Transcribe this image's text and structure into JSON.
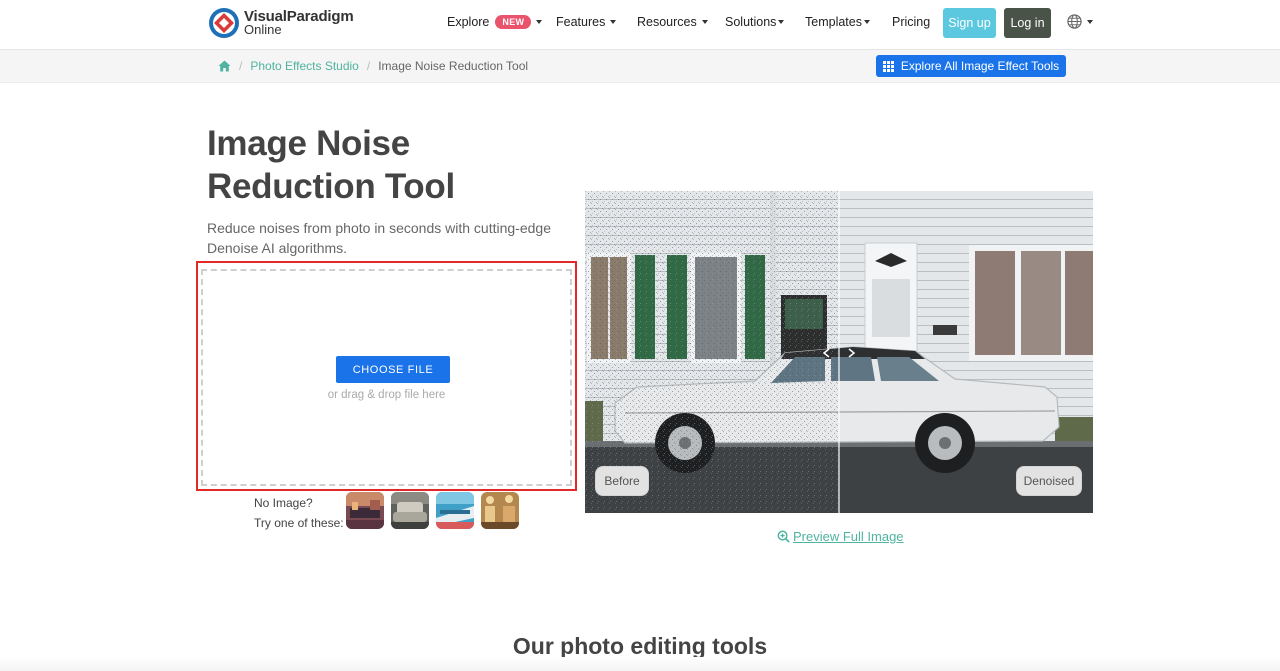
{
  "header": {
    "logo": {
      "line1": "VisualParadigm",
      "line2": "Online"
    },
    "nav": {
      "explore": "Explore",
      "explore_badge": "NEW",
      "features": "Features",
      "resources": "Resources",
      "solutions": "Solutions",
      "templates": "Templates",
      "pricing": "Pricing"
    },
    "signup": "Sign up",
    "login": "Log in"
  },
  "breadcrumb": {
    "home_icon": "home-icon",
    "items": [
      "Photo Effects Studio",
      "Image Noise Reduction Tool"
    ]
  },
  "explore_tools_button": "Explore All Image Effect Tools",
  "hero": {
    "title": "Image Noise Reduction Tool",
    "subtitle": "Reduce noises from photo in seconds with cutting-edge Denoise AI algorithms."
  },
  "upload": {
    "choose_file": "CHOOSE FILE",
    "drag_hint": "or drag & drop file here"
  },
  "samples": {
    "line1": "No Image?",
    "line2": "Try one of these:"
  },
  "compare": {
    "before_label": "Before",
    "after_label": "Denoised"
  },
  "preview_link": "Preview Full Image",
  "section_title": "Our photo editing tools",
  "colors": {
    "primary_blue": "#1a73e8",
    "teal_link": "#4fb3a0",
    "signup": "#5bc8e0",
    "login": "#4a5347",
    "highlight_red": "#e32828",
    "badge_pink": "#e9536b"
  }
}
